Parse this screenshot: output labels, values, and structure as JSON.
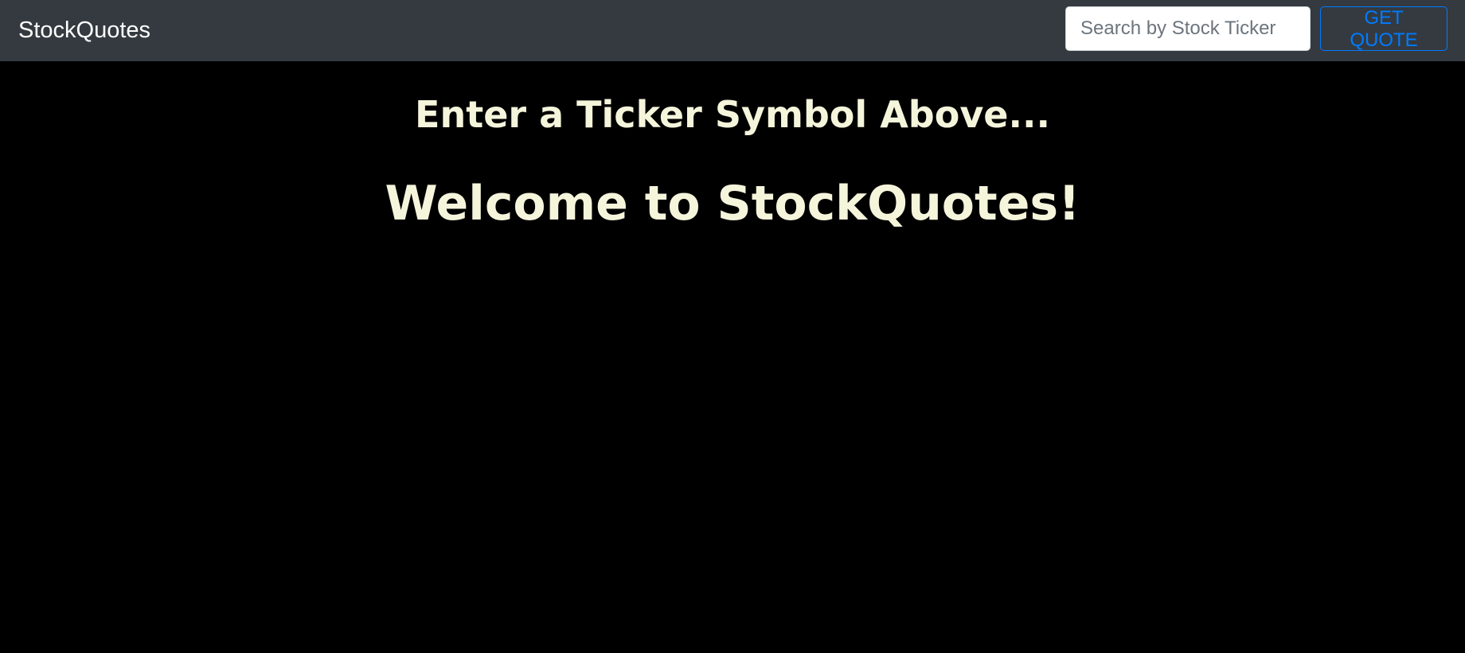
{
  "navbar": {
    "brand": "StockQuotes",
    "search": {
      "placeholder": "Search by Stock Ticker",
      "value": ""
    },
    "quote_button_label": "GET QUOTE"
  },
  "main": {
    "prompt": "Enter a Ticker Symbol Above...",
    "welcome": "Welcome to StockQuotes!"
  },
  "colors": {
    "navbar_bg": "#343a40",
    "page_bg": "#000000",
    "heading_text": "#f5f5dc",
    "accent": "#007bff"
  }
}
